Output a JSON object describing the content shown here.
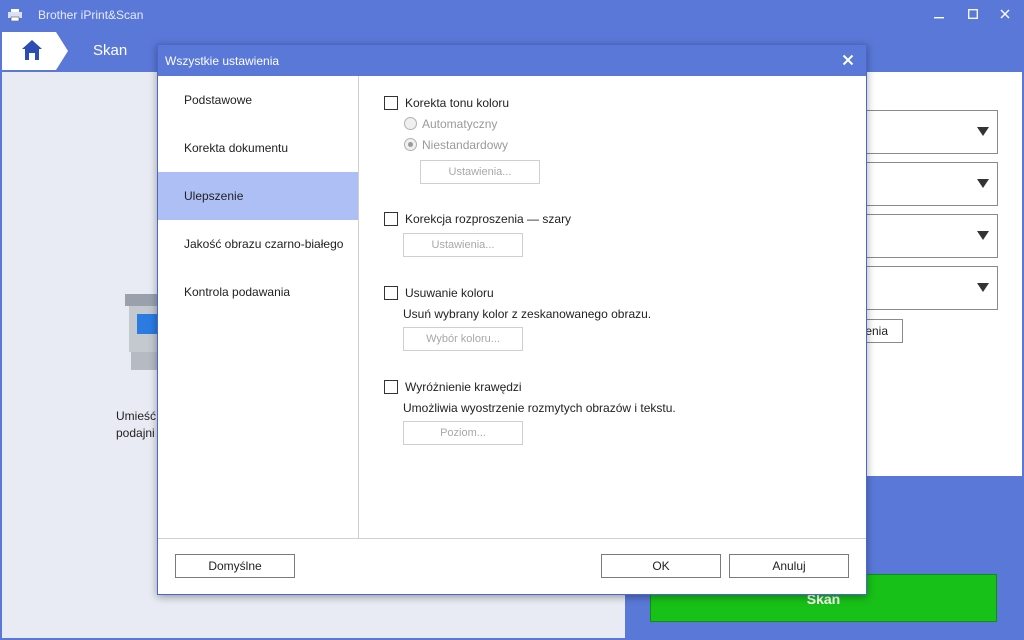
{
  "app": {
    "title": "Brother iPrint&Scan"
  },
  "nav": {
    "section_label": "Skan"
  },
  "left": {
    "hint_line1": "Umieść",
    "hint_line2": "podajni"
  },
  "right": {
    "partial_button_label": "enia",
    "scan_button_label": "Skan"
  },
  "dialog": {
    "title": "Wszystkie ustawienia",
    "nav_items": [
      {
        "label": "Podstawowe",
        "active": false
      },
      {
        "label": "Korekta dokumentu",
        "active": false
      },
      {
        "label": "Ulepszenie",
        "active": true
      },
      {
        "label": "Jakość obrazu czarno-białego",
        "active": false
      },
      {
        "label": "Kontrola podawania",
        "active": false
      }
    ],
    "sections": {
      "color_tone": {
        "label": "Korekta tonu koloru",
        "checked": false,
        "options": [
          {
            "label": "Automatyczny",
            "selected": false
          },
          {
            "label": "Niestandardowy",
            "selected": true
          }
        ],
        "settings_button": "Ustawienia..."
      },
      "bleed_through": {
        "label": "Korekcja rozproszenia — szary",
        "checked": false,
        "settings_button": "Ustawienia..."
      },
      "color_drop": {
        "label": "Usuwanie koloru",
        "checked": false,
        "description": "Usuń wybrany kolor z zeskanowanego obrazu.",
        "button": "Wybór koloru..."
      },
      "edge_emphasis": {
        "label": "Wyróżnienie krawędzi",
        "checked": false,
        "description": "Umożliwia wyostrzenie rozmytych obrazów i tekstu.",
        "button": "Poziom..."
      }
    },
    "footer": {
      "default_button": "Domyślne",
      "ok_button": "OK",
      "cancel_button": "Anuluj"
    }
  },
  "colors": {
    "accent": "#5a78d8",
    "nav_active": "#aebff6",
    "scan_green": "#17c117",
    "left_bg": "#e9ebf4"
  },
  "icons": [
    "app-printer-icon",
    "minimize-icon",
    "maximize-icon",
    "close-icon",
    "home-icon",
    "scanner-icon",
    "dialog-close-icon",
    "dropdown-arrow-icon"
  ]
}
